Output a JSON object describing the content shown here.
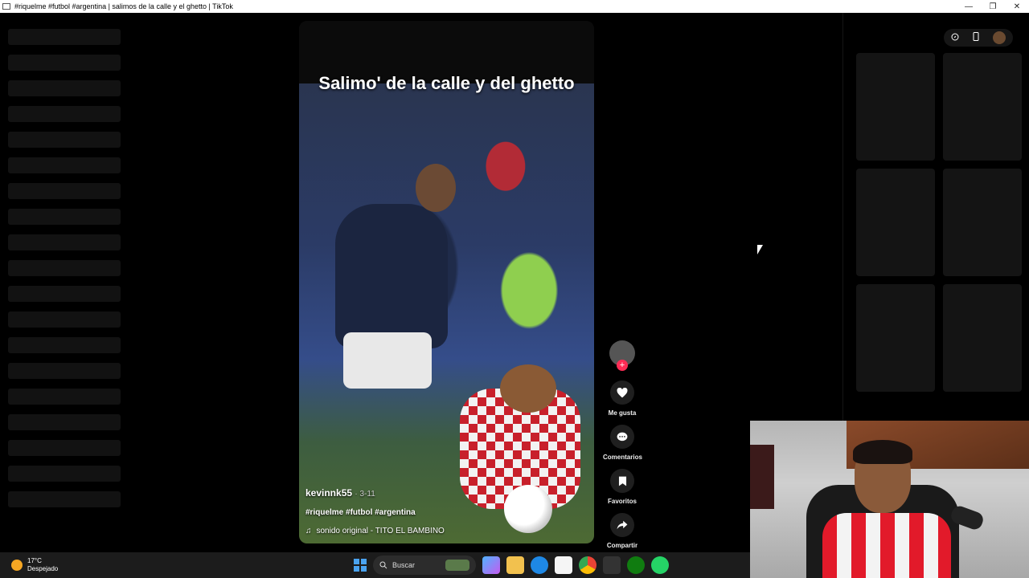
{
  "window": {
    "title": "#riquelme #futbol #argentina | salimos de la calle y el ghetto | TikTok",
    "controls": [
      "—",
      "❐",
      "✕"
    ]
  },
  "video": {
    "caption": "Salimo' de la calle y del ghetto",
    "username": "kevinnk55",
    "date": "· 3-11",
    "hashtags": "#riquelme #futbol #argentina",
    "music_icon": "♫",
    "music": "sonido original - TITO EL BAMBINO"
  },
  "actions": {
    "follow_symbol": "+",
    "like_label": "Me gusta",
    "comments_label": "Comentarios",
    "favorites_label": "Favoritos",
    "share_label": "Compartir",
    "icons": [
      "heart-icon",
      "comment-icon",
      "bookmark-icon",
      "share-icon"
    ]
  },
  "topbar": {
    "icons": [
      "compass-icon",
      "phone-icon",
      "profile-avatar"
    ]
  },
  "taskbar": {
    "temperature": "17°C",
    "weather": "Despejado",
    "search_placeholder": "Buscar"
  },
  "colors": {
    "accent": "#fe2c55",
    "background": "#000000",
    "skeleton": "#121212"
  }
}
